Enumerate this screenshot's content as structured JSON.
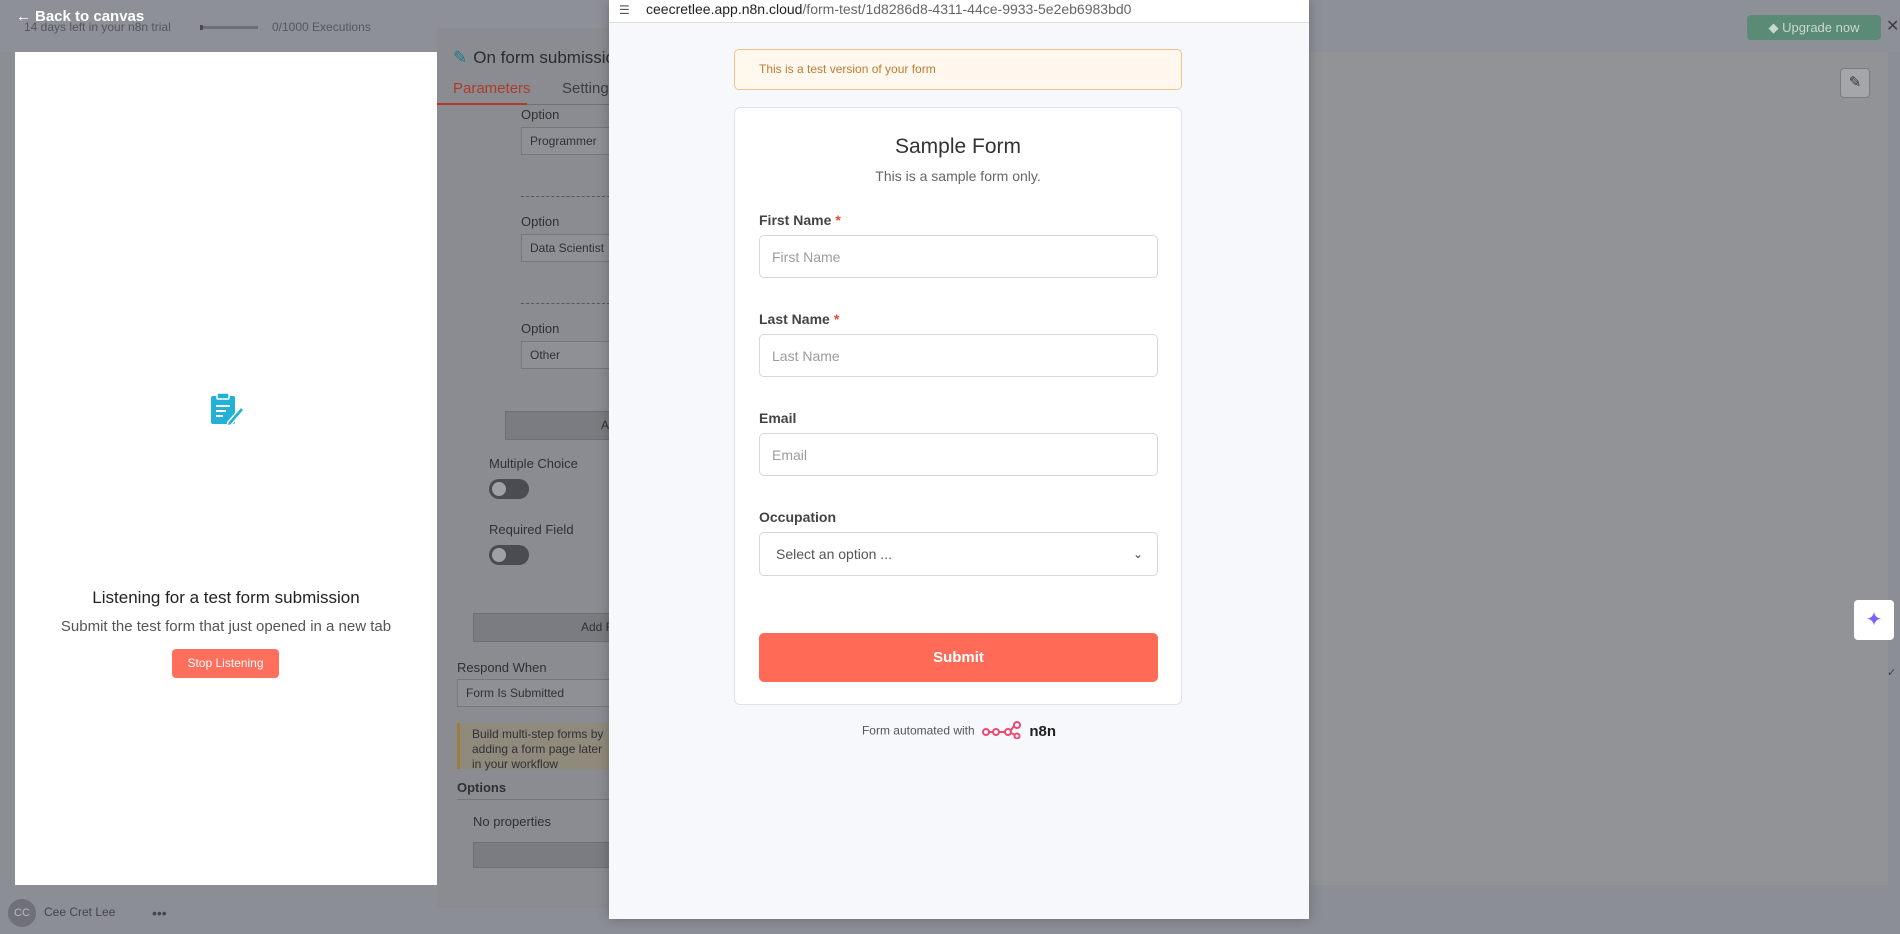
{
  "app": {
    "back_label": "Back to canvas",
    "trial_text": "14 days left in your n8n trial",
    "executions_text": "0/1000 Executions",
    "upgrade_label": "Upgrade now"
  },
  "left_panel": {
    "title": "Listening for a test form submission",
    "subtitle": "Submit the test form that just opened in a new tab",
    "stop_label": "Stop Listening"
  },
  "user": {
    "initials": "CC",
    "name": "Cee Cret Lee"
  },
  "node_panel": {
    "title": "On form submission",
    "tabs": [
      "Parameters",
      "Settings"
    ],
    "options": [
      {
        "label": "Option",
        "value": "Programmer"
      },
      {
        "label": "Option",
        "value": "Data Scientist"
      },
      {
        "label": "Option",
        "value": "Other"
      }
    ],
    "add_option_label": "Add Option",
    "multiple_choice_label": "Multiple Choice",
    "required_field_label": "Required Field",
    "add_field_label": "Add Form Element",
    "respond_when_label": "Respond When",
    "respond_when_value": "Form Is Submitted",
    "note": "Build multi-step forms by adding a form page later in your workflow",
    "options_label": "Options",
    "no_properties": "No properties"
  },
  "popup": {
    "url_domain": "ceecretlee.app.n8n.cloud",
    "url_path": "/form-test/1d8286d8-4311-44ce-9933-5e2eb6983bd0",
    "banner": "This is a test version of your form",
    "form_title": "Sample Form",
    "form_subtitle": "This is a sample form only.",
    "fields": {
      "first_name": {
        "label": "First Name",
        "placeholder": "First Name",
        "required_mark": "*"
      },
      "last_name": {
        "label": "Last Name",
        "placeholder": "Last Name",
        "required_mark": "*"
      },
      "email": {
        "label": "Email",
        "placeholder": "Email"
      },
      "occupation": {
        "label": "Occupation",
        "selected": "Select an option ..."
      }
    },
    "submit_label": "Submit",
    "footer_text": "Form automated with",
    "footer_brand": "n8n"
  },
  "colors": {
    "accent": "#ff6b57",
    "banner_text": "#c27b2d",
    "required": "#e24a3a"
  }
}
